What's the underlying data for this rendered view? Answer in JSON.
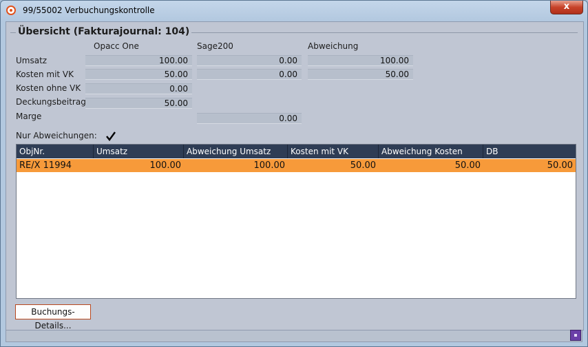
{
  "window": {
    "title": "99/55002 Verbuchungskontrolle",
    "close_glyph": "x"
  },
  "group": {
    "title": "Übersicht (Fakturajournal: 104)"
  },
  "columns": {
    "opacc": "Opacc One",
    "sage": "Sage200",
    "abweichung": "Abweichung"
  },
  "rows": {
    "umsatz": {
      "label": "Umsatz",
      "opacc": "100.00",
      "sage": "0.00",
      "abweichung": "100.00"
    },
    "kosten_mit_vk": {
      "label": "Kosten mit VK",
      "opacc": "50.00",
      "sage": "0.00",
      "abweichung": "50.00"
    },
    "kosten_ohne_vk": {
      "label": "Kosten ohne VK",
      "opacc": "0.00"
    },
    "deckungsbeitrag": {
      "label": "Deckungsbeitrag",
      "opacc": "50.00"
    },
    "marge": {
      "label": "Marge",
      "sage": "0.00"
    }
  },
  "filter": {
    "label": "Nur Abweichungen:",
    "checked": true
  },
  "grid": {
    "headers": [
      "ObjNr.",
      "Umsatz",
      "Abweichung Umsatz",
      "Kosten mit VK",
      "Abweichung Kosten",
      "DB"
    ],
    "rows": [
      [
        "RE/X 11994",
        "100.00",
        "100.00",
        "50.00",
        "50.00",
        "50.00"
      ]
    ],
    "selected_row_color": "#f79a3a",
    "header_color": "#2f3d55"
  },
  "buttons": {
    "details": "Buchungs-Details..."
  }
}
